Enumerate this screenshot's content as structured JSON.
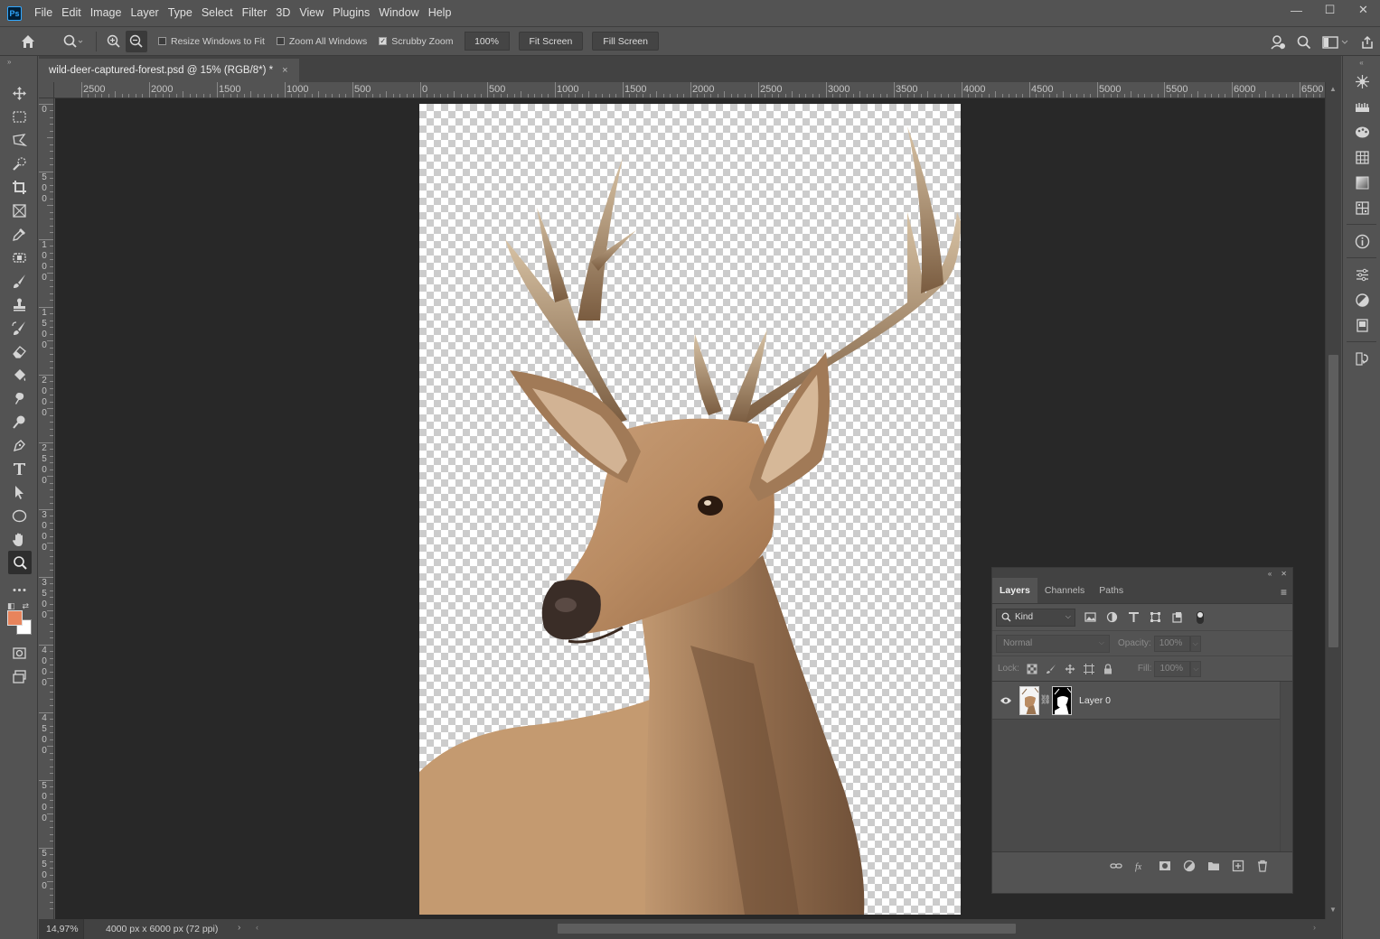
{
  "app": {
    "logo": "Ps",
    "menu": [
      "File",
      "Edit",
      "Image",
      "Layer",
      "Type",
      "Select",
      "Filter",
      "3D",
      "View",
      "Plugins",
      "Window",
      "Help"
    ],
    "window_controls": {
      "minimize": "—",
      "maximize": "☐",
      "close": "✕"
    }
  },
  "options_bar": {
    "resize_windows": {
      "label": "Resize Windows to Fit",
      "checked": false
    },
    "zoom_all": {
      "label": "Zoom All Windows",
      "checked": false
    },
    "scrubby_zoom": {
      "label": "Scrubby Zoom",
      "checked": true
    },
    "zoom_value": "100%",
    "fit_screen": "Fit Screen",
    "fill_screen": "Fill Screen"
  },
  "toolbar": {
    "collapse": "»",
    "tools": [
      "move-tool",
      "marquee-tool",
      "lasso-tool",
      "quick-selection-tool",
      "crop-tool",
      "frame-tool",
      "eyedropper-tool",
      "patch-tool",
      "brush-tool",
      "stamp-tool",
      "history-brush-tool",
      "eraser-tool",
      "paint-bucket-tool",
      "blur-tool",
      "dodge-tool",
      "pen-tool",
      "type-tool",
      "path-selection-tool",
      "ellipse-tool",
      "hand-tool",
      "zoom-tool",
      "more-tools"
    ],
    "active_tool": "zoom-tool",
    "foreground_color": "#e8845c",
    "background_color": "#ffffff"
  },
  "document": {
    "tab_title": "wild-deer-captured-forest.psd @ 15% (RGB/8*) *",
    "tab_close": "×",
    "zoom": "14,97%",
    "info": "4000 px x 6000 px (72 ppi)"
  },
  "rulers": {
    "horizontal": [
      "2500",
      "2000",
      "1500",
      "1000",
      "500",
      "0",
      "500",
      "1000",
      "1500",
      "2000",
      "2500",
      "3000",
      "3500",
      "4000",
      "4500",
      "5000",
      "5500",
      "6000",
      "6500"
    ],
    "vertical": [
      "0",
      "500",
      "1000",
      "1500",
      "2000",
      "2500",
      "3000",
      "3500",
      "4000",
      "4500",
      "5000",
      "5500"
    ]
  },
  "layers_panel": {
    "tabs": [
      "Layers",
      "Channels",
      "Paths"
    ],
    "active_tab": "Layers",
    "filter_kind": "Kind",
    "blend_mode": "Normal",
    "opacity_label": "Opacity:",
    "opacity_value": "100%",
    "lock_label": "Lock:",
    "fill_label": "Fill:",
    "fill_value": "100%",
    "layers": [
      {
        "name": "Layer 0",
        "visible": true
      }
    ]
  },
  "right_dock": [
    "brush-settings-icon",
    "brushes-icon",
    "color-palette-icon",
    "swatches-icon",
    "gradients-icon",
    "patterns-icon",
    "info-icon",
    "properties-icon",
    "adjustments-icon",
    "libraries-icon",
    "history-icon"
  ]
}
